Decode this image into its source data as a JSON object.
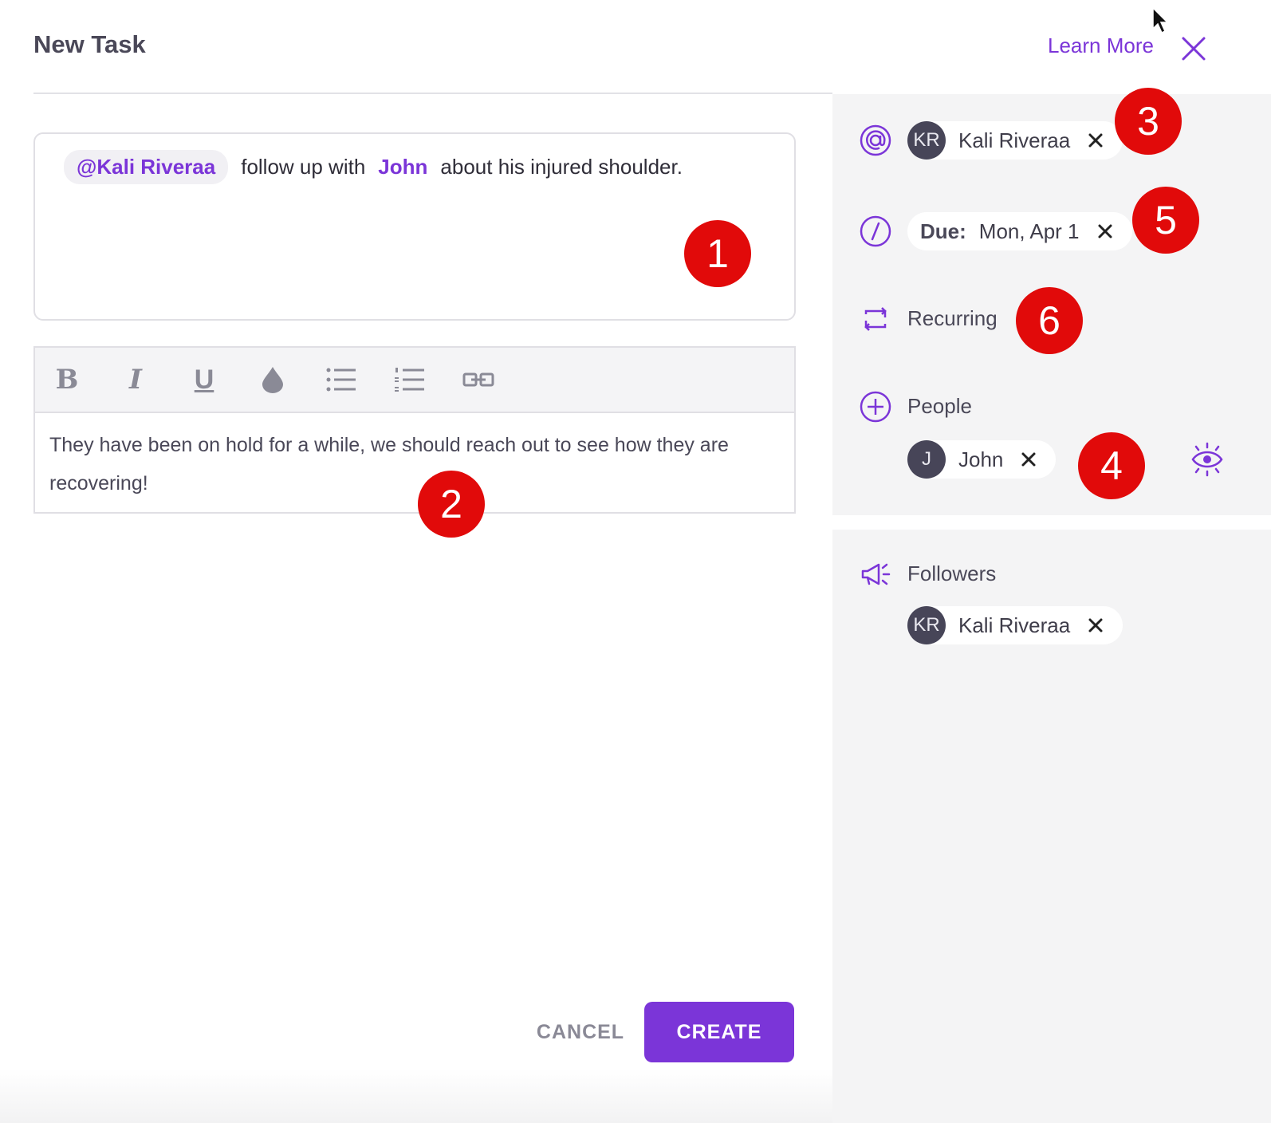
{
  "header": {
    "title": "New Task",
    "learn_more": "Learn More"
  },
  "task": {
    "mention": "@Kali Riveraa",
    "text_a": "follow up with",
    "person": "John",
    "text_b": "about his injured shoulder."
  },
  "editor": {
    "toolbar": {
      "bold": "B",
      "italic": "I",
      "underline": "U"
    },
    "body": "They have been on hold for a while, we should reach out to see how they are recovering!"
  },
  "footer": {
    "cancel_label": "CANCEL",
    "create_label": "CREATE"
  },
  "sidebar": {
    "assignee": {
      "initials": "KR",
      "name": "Kali Riveraa"
    },
    "due": {
      "label": "Due:",
      "value": "Mon, Apr 1"
    },
    "recurring_label": "Recurring",
    "people_label": "People",
    "people": [
      {
        "initials": "J",
        "name": "John"
      }
    ],
    "followers_label": "Followers",
    "followers": [
      {
        "initials": "KR",
        "name": "Kali Riveraa"
      }
    ]
  },
  "annotations": [
    "1",
    "2",
    "3",
    "4",
    "5",
    "6"
  ],
  "colors": {
    "accent": "#7b35d8",
    "marker": "#e10a0a",
    "sidebar_bg": "#f4f4f5",
    "avatar_bg": "#474558"
  },
  "icons": [
    "close-icon",
    "at-sign-icon",
    "slash-clock-icon",
    "recurring-icon",
    "plus-circle-icon",
    "eye-icon",
    "megaphone-icon",
    "cursor-icon"
  ]
}
